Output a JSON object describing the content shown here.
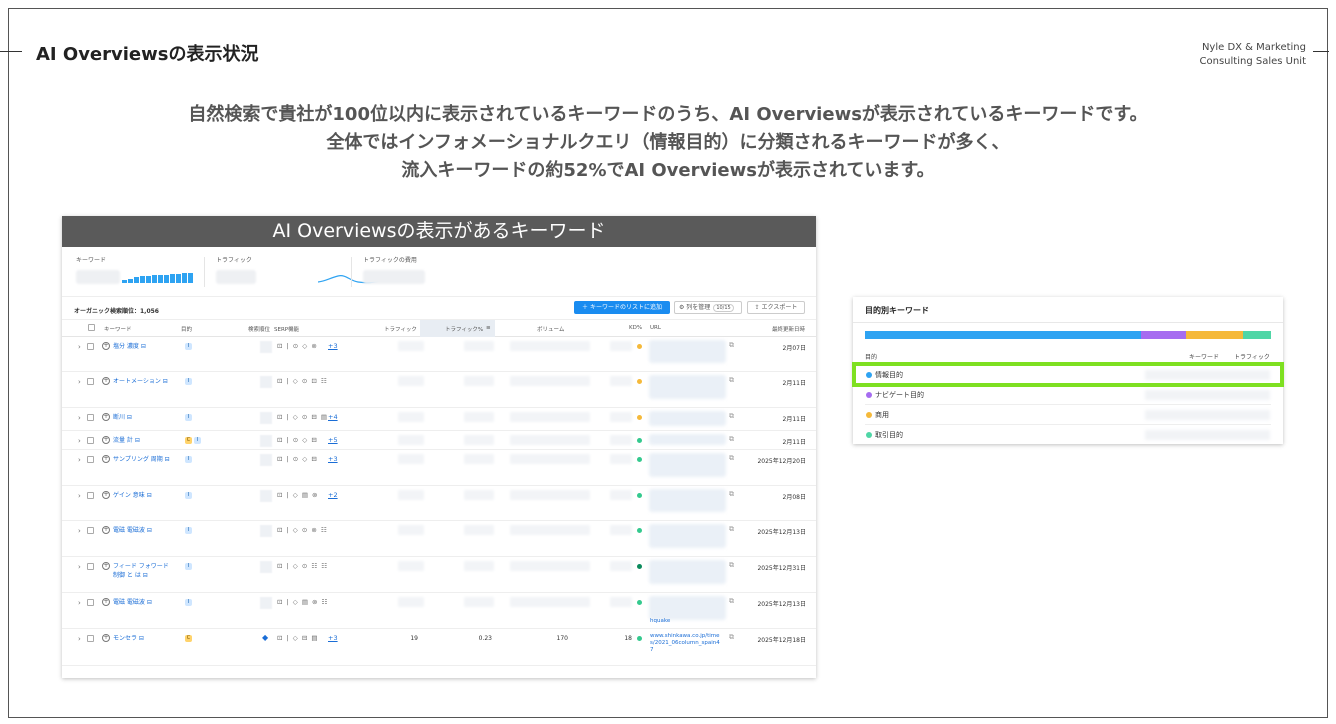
{
  "page": {
    "title": "AI Overviewsの表示状況",
    "brand_line1": "Nyle DX & Marketing",
    "brand_line2": "Consulting Sales Unit",
    "headline_line1": "自然検索で貴社が100位以内に表示されているキーワードのうち、AI Overviewsが表示されているキーワードです。",
    "headline_line2": "全体ではインフォメーショナルクエリ（情報目的）に分類されるキーワードが多く、",
    "headline_line3": "流入キーワードの約52%でAI Overviewsが表示されています。"
  },
  "colors": {
    "accent_blue": "#2ea3f2",
    "button_blue": "#1a8cf0",
    "highlight_green": "#7ee021",
    "banner_gray": "#5a5a5a",
    "intent_info": "#2ea3f2",
    "intent_nav": "#a66cf0",
    "intent_commercial": "#f5b93a",
    "intent_transactional": "#4fd6a6"
  },
  "keywords_panel": {
    "banner": "AI Overviewsの表示があるキーワード",
    "stat_keywords_label": "キーワード",
    "stat_traffic_label": "トラフィック",
    "stat_traffic_cost_label": "トラフィックの費用",
    "organic_count_label": "オーガニック検索順位：1,056",
    "add_button": "＋ キーワードのリストに追加",
    "manage_columns": "列を管理",
    "column_count": "10/15",
    "export_button": "エクスポート",
    "columns": {
      "keyword": "キーワード",
      "intent": "目的",
      "position": "検索順位",
      "serp": "SERP機能",
      "traffic": "トラフィック",
      "traffic_pct": "トラフィック%",
      "volume": "ボリューム",
      "kd": "KD%",
      "url": "URL",
      "updated": "最終更新日時"
    },
    "rows": [
      {
        "keyword": "塩分 濃度 ⊟",
        "intents": [
          "I"
        ],
        "serp": "⊡ | ⊙ ◇ ⊚ ",
        "more": "+3",
        "kd_color": "#f5b93a",
        "date": "2月07日"
      },
      {
        "keyword": "オートメーション ⊟",
        "intents": [
          "I"
        ],
        "serp": "⊡ | ◇ ⊙ ⊡ ☷",
        "more": "",
        "kd_color": "#f5b93a",
        "date": "2月11日"
      },
      {
        "keyword": "断川 ⊟",
        "intents": [
          "I"
        ],
        "serp": "⊡ | ◇ ⊙ ⊟ ▤ ",
        "more": "+4",
        "kd_color": "#f5b93a",
        "date": "2月11日"
      },
      {
        "keyword": "流量 計 ⊟",
        "intents": [
          "C",
          "I"
        ],
        "serp": "⊡ | ⊙ ◇ ⊟ ",
        "more": "+5",
        "kd_color": "#34c98e",
        "date": "2月11日"
      },
      {
        "keyword": "サンプリング 周期 ⊟",
        "intents": [
          "I"
        ],
        "serp": "⊡ | ⊙ ◇ ⊟ ",
        "more": "+3",
        "kd_color": "#34c98e",
        "date": "2025年12月20日"
      },
      {
        "keyword": "ゲイン 意味 ⊟",
        "intents": [
          "I"
        ],
        "serp": "⊡ | ◇ ▤ ⊚ ",
        "more": "+2",
        "kd_color": "#34c98e",
        "date": "2月08日"
      },
      {
        "keyword": "電磁 電磁波 ⊟",
        "intents": [
          "I"
        ],
        "serp": "⊡ | ◇ ⊙ ⊚ ☷",
        "more": "",
        "kd_color": "#34c98e",
        "date": "2025年12月13日"
      },
      {
        "keyword": "フィード フォワード 制御 と は ⊟",
        "intents": [
          "I"
        ],
        "serp": "⊡ | ◇ ⊙ ☷ ☷",
        "more": "",
        "kd_color": "#0b8a5c",
        "date": "2025年12月31日"
      },
      {
        "keyword": "電磁 電磁波 ⊟",
        "intents": [
          "I"
        ],
        "serp": "⊡ | ◇ ▤ ⊚ ☷",
        "more": "",
        "kd_color": "#34c98e",
        "date": "2025年12月13日",
        "url": "hquake"
      },
      {
        "keyword": "モンセラ ⊟",
        "intents": [
          "C"
        ],
        "serp": "⊡ | ◇ ⊟ ▤ ",
        "more": "+3",
        "kd_color": "#34c98e",
        "date": "2025年12月18日",
        "traffic": "19",
        "traffic_pct": "0.23",
        "volume": "170",
        "kd": "18",
        "url": "www.shinkawa.co.jp/times/2021_06column_spain47"
      }
    ]
  },
  "intent_panel": {
    "title": "目的別キーワード",
    "col_intent": "目的",
    "col_keywords": "キーワード",
    "col_traffic": "トラフィック",
    "stack_shares": [
      0.68,
      0.11,
      0.14,
      0.07
    ],
    "rows": [
      {
        "label": "情報目的",
        "color": "#2ea3f2"
      },
      {
        "label": "ナビゲート目的",
        "color": "#a66cf0"
      },
      {
        "label": "商用",
        "color": "#f5b93a"
      },
      {
        "label": "取引目的",
        "color": "#4fd6a6"
      }
    ]
  }
}
